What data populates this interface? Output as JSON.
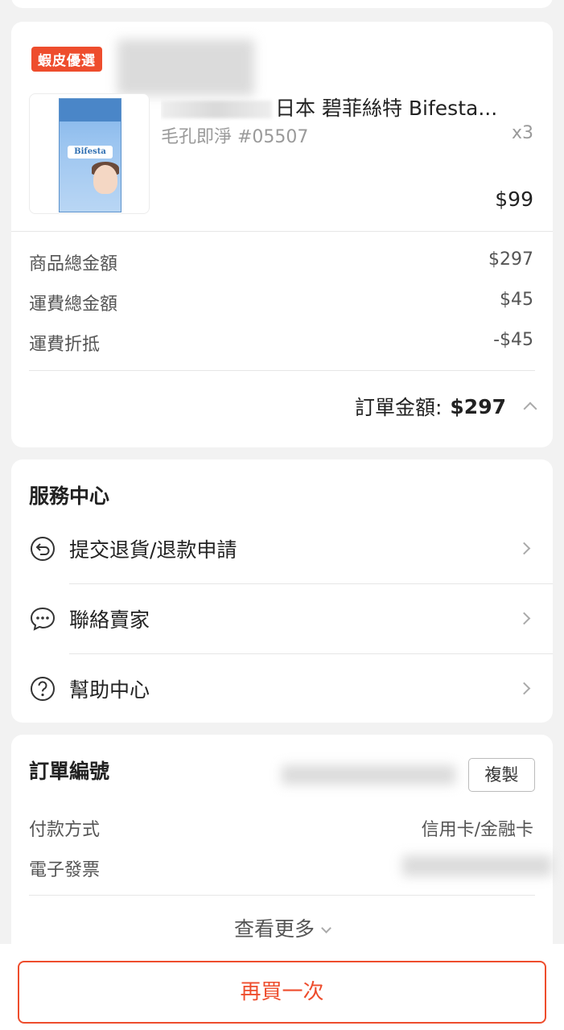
{
  "product": {
    "badge": "蝦皮優選",
    "title": "日本 碧菲絲特 Bifesta...",
    "variant": "毛孔即淨 #05507",
    "quantity": "x3",
    "unit_price": "$99",
    "image_text": "Bifesta"
  },
  "summary": {
    "rows": [
      {
        "label": "商品總金額",
        "value": "$297"
      },
      {
        "label": "運費總金額",
        "value": "$45"
      },
      {
        "label": "運費折抵",
        "value": "-$45"
      }
    ],
    "order_total_label": "訂單金額:",
    "order_total_value": "$297"
  },
  "service_center": {
    "title": "服務中心",
    "items": [
      {
        "label": "提交退貨/退款申請",
        "icon": "return-icon"
      },
      {
        "label": "聯絡賣家",
        "icon": "chat-icon"
      },
      {
        "label": "幫助中心",
        "icon": "help-icon"
      }
    ]
  },
  "order_info": {
    "order_no_label": "訂單編號",
    "copy_label": "複製",
    "payment_label": "付款方式",
    "payment_value": "信用卡/金融卡",
    "invoice_label": "電子發票",
    "view_more": "查看更多"
  },
  "actions": {
    "buy_again": "再買一次"
  },
  "colors": {
    "brand": "#ee4d2d",
    "background": "#f2f2f2"
  }
}
